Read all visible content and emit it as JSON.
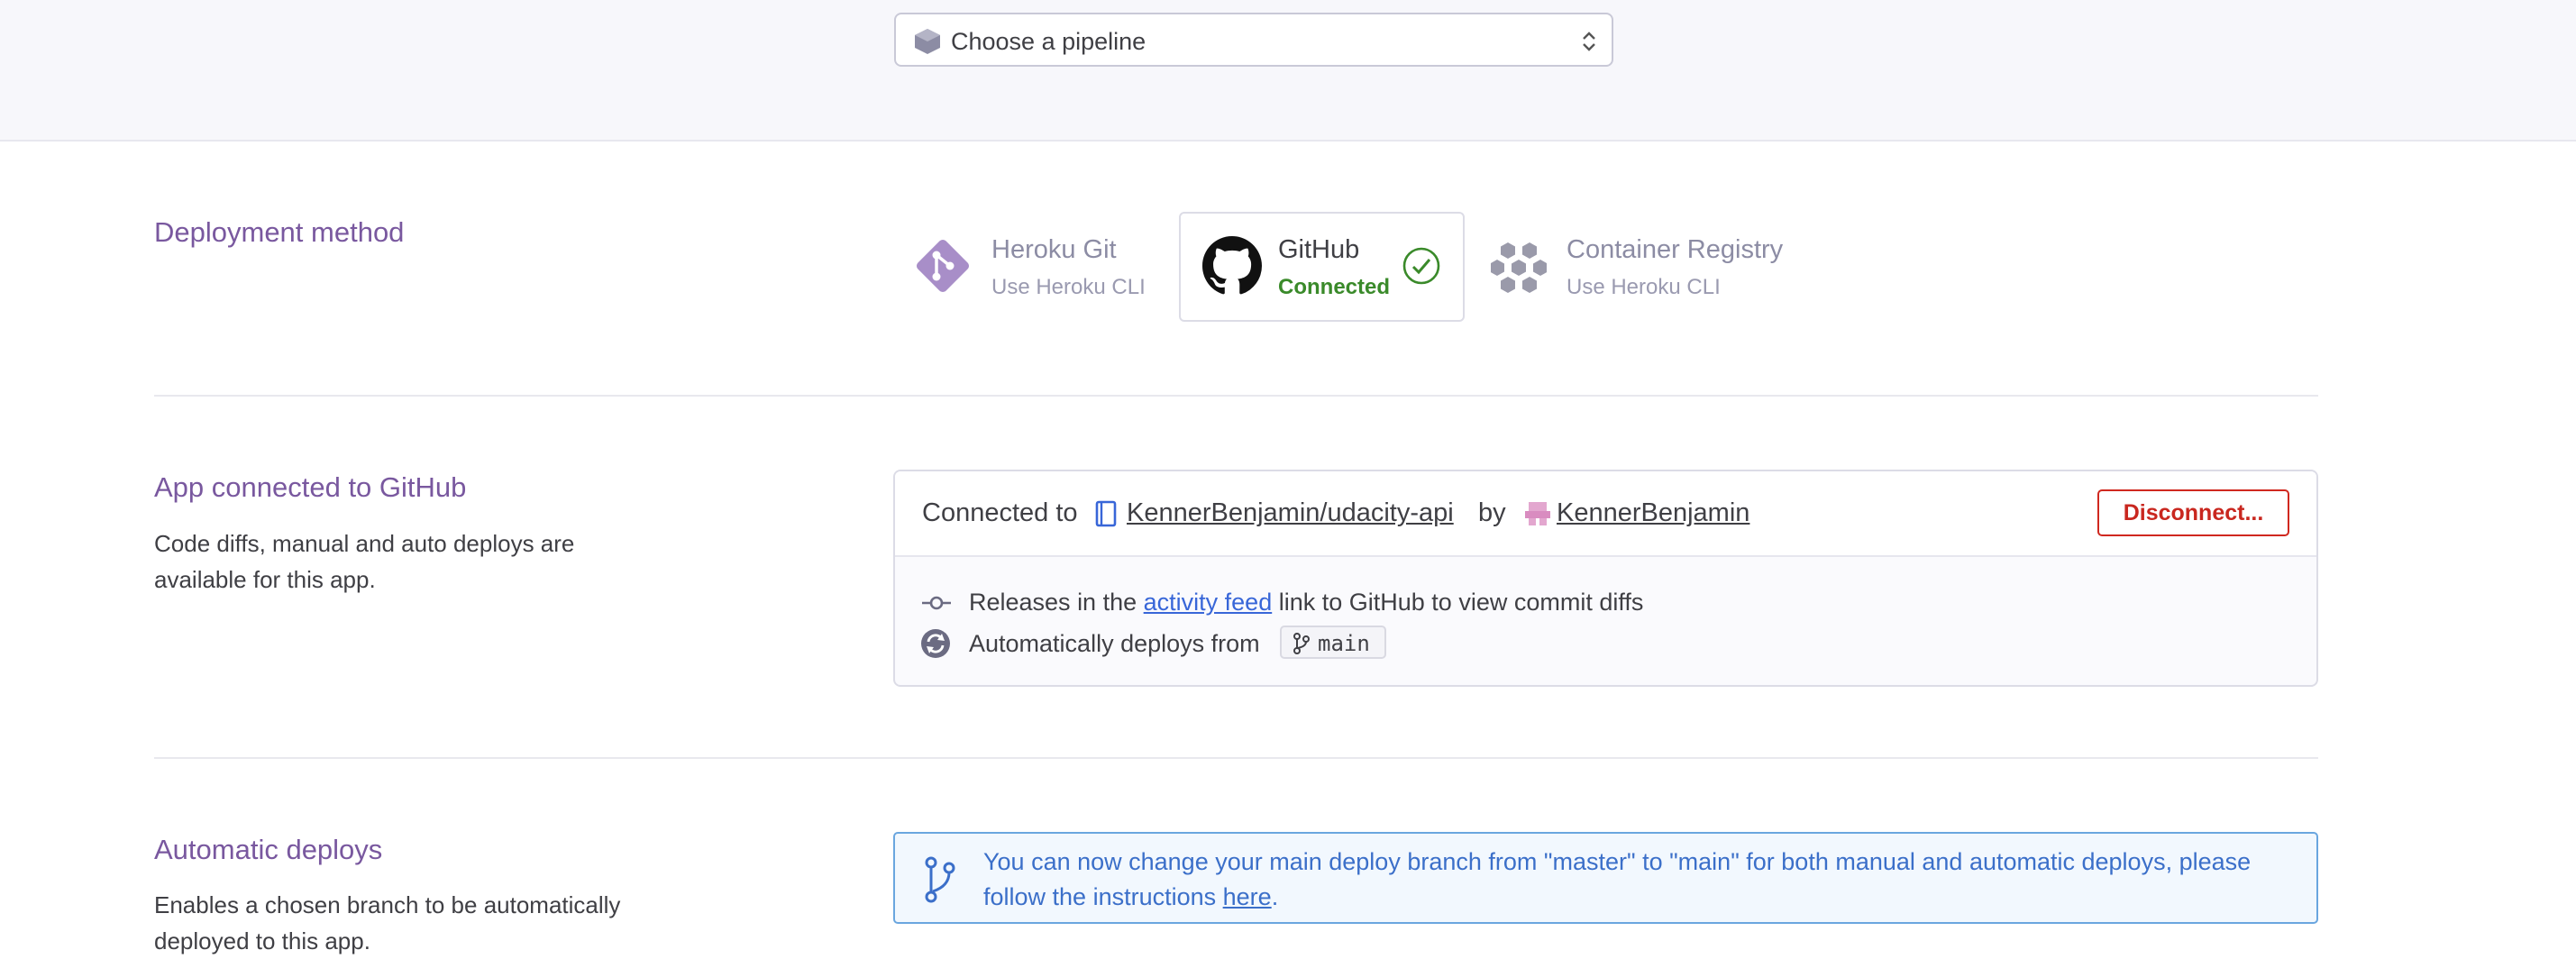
{
  "pipeline": {
    "label": "Choose a pipeline"
  },
  "deployment_method": {
    "title": "Deployment method",
    "methods": [
      {
        "name": "Heroku Git",
        "sub": "Use Heroku CLI",
        "icon": "git-icon",
        "active": false
      },
      {
        "name": "GitHub",
        "sub": "Connected",
        "icon": "github-icon",
        "active": true
      },
      {
        "name": "Container Registry",
        "sub": "Use Heroku CLI",
        "icon": "container-registry-icon",
        "active": false
      }
    ]
  },
  "app_connected": {
    "title": "App connected to GitHub",
    "description": "Code diffs, manual and auto deploys are available for this app.",
    "connected_to_label": "Connected to",
    "repo": "KennerBenjamin/udacity-api",
    "by_label": "by",
    "user": "KennerBenjamin",
    "disconnect_label": "Disconnect...",
    "releases_prefix": "Releases in the",
    "activity_feed_link": "activity feed",
    "releases_suffix": "link to GitHub to view commit diffs",
    "auto_deploys_label": "Automatically deploys from",
    "branch": "main"
  },
  "automatic_deploys": {
    "title": "Automatic deploys",
    "description": "Enables a chosen branch to be automatically deployed to this app.",
    "info_text": "You can now change your main deploy branch from \"master\" to \"main\" for both manual and automatic deploys, please follow the instructions",
    "info_link": "here",
    "info_end": "."
  },
  "colors": {
    "accent_purple": "#79589f",
    "link_blue": "#3866d8",
    "danger_red": "#c9271f",
    "success_green": "#3a8a2a"
  }
}
